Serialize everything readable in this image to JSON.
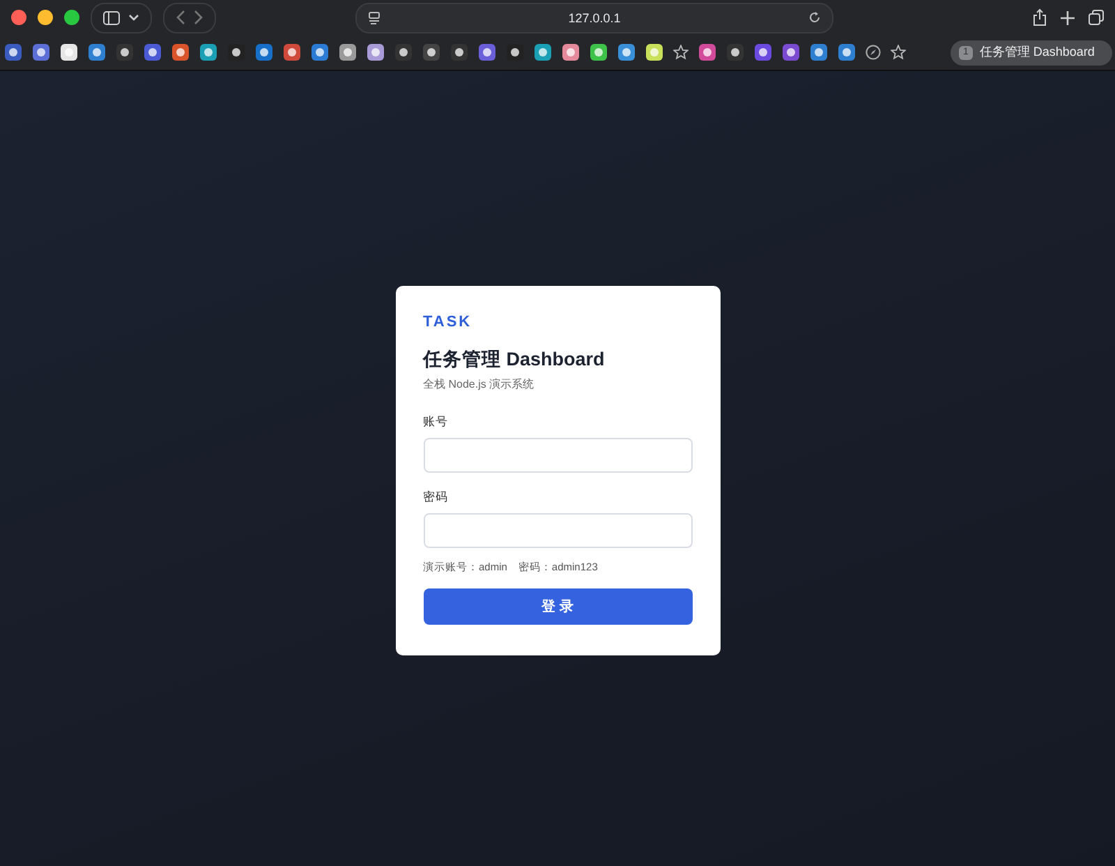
{
  "browser": {
    "address": "127.0.0.1",
    "tab": {
      "number": "1",
      "title": "任务管理 Dashboard",
      "selected": true
    }
  },
  "login": {
    "brand": "TASK",
    "title": "任务管理 Dashboard",
    "subtitle": "全栈 Node.js 演示系统",
    "fields": [
      {
        "label": "账号"
      },
      {
        "label": "密码"
      }
    ],
    "hint": "演示账号：admin　密码：admin123",
    "submit": "登 录"
  }
}
